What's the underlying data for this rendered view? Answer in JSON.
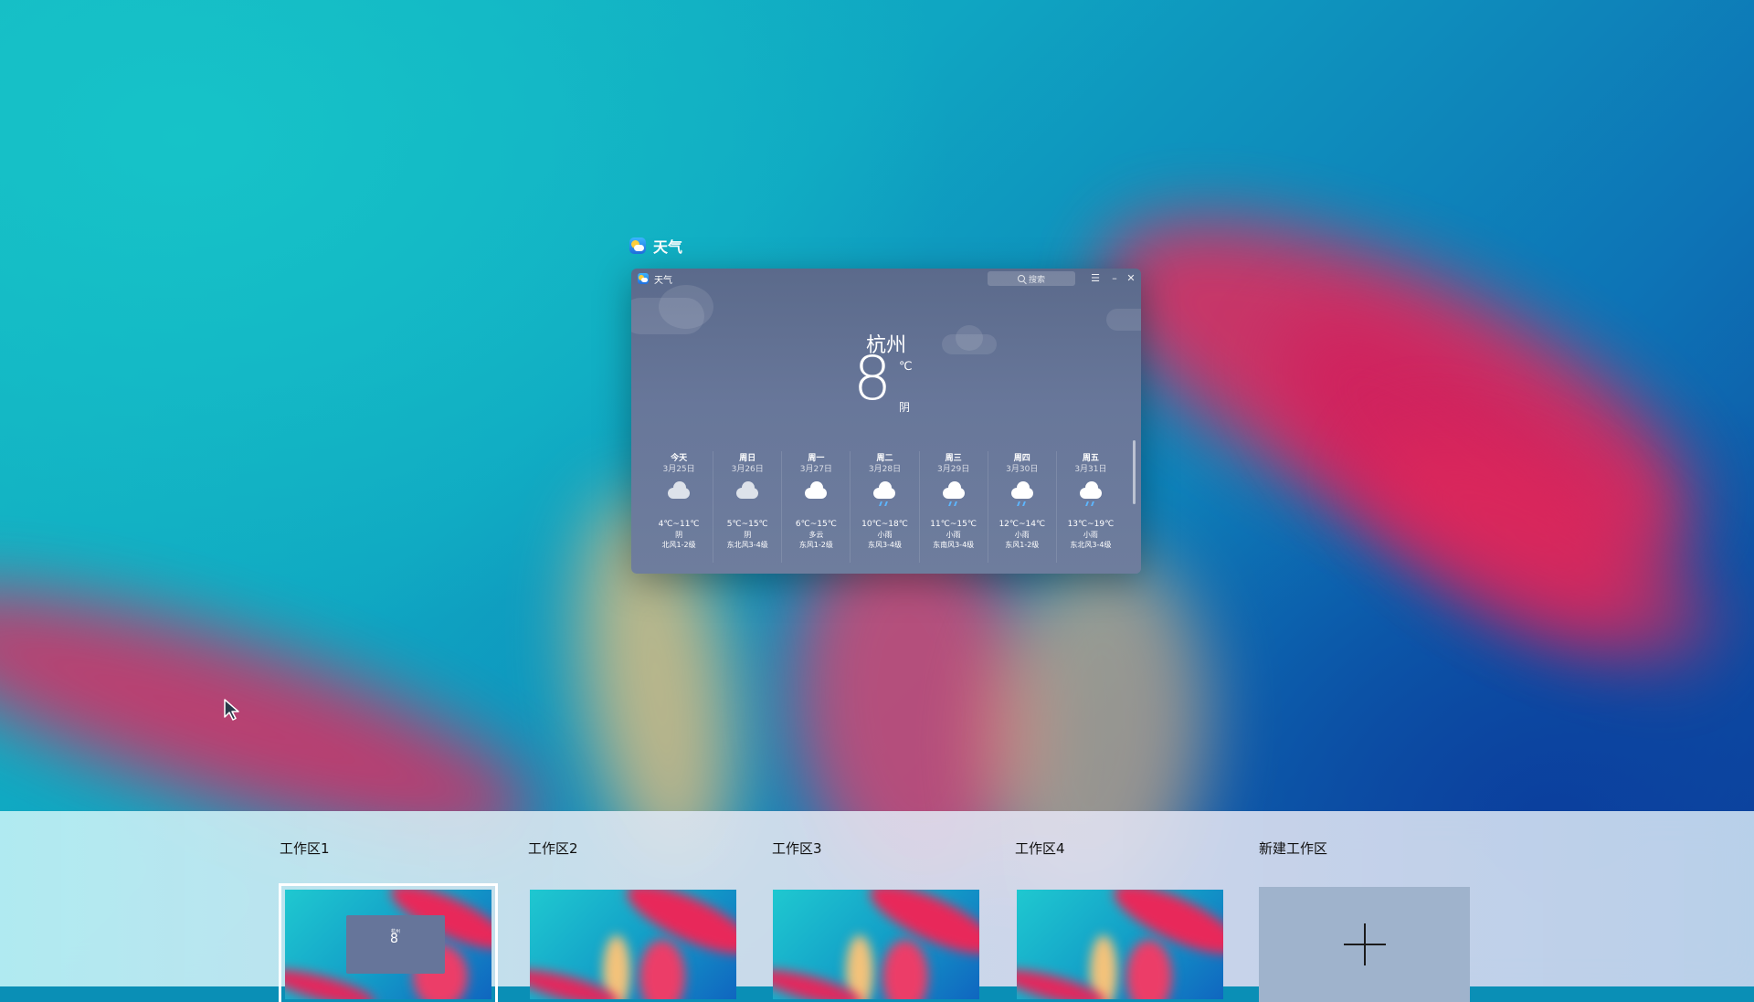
{
  "window_label": {
    "title": "天气",
    "icon": "weather-app-icon"
  },
  "weather_window": {
    "title": "天气",
    "search_placeholder": "搜索",
    "menu_icon": "☰",
    "minimize_icon": "–",
    "close_icon": "✕",
    "city": "杭州",
    "current_temp": "8",
    "unit": "℃",
    "condition": "阴",
    "forecast": [
      {
        "day": "今天",
        "date": "3月25日",
        "icon": "cloudy-icon",
        "range": "4℃~11℃",
        "cond": "阴",
        "wind": "北风1-2级"
      },
      {
        "day": "周日",
        "date": "3月26日",
        "icon": "cloudy-icon",
        "range": "5℃~15℃",
        "cond": "阴",
        "wind": "东北风3-4级"
      },
      {
        "day": "周一",
        "date": "3月27日",
        "icon": "partly-cloudy-icon",
        "range": "6℃~15℃",
        "cond": "多云",
        "wind": "东风1-2级"
      },
      {
        "day": "周二",
        "date": "3月28日",
        "icon": "light-rain-icon",
        "range": "10℃~18℃",
        "cond": "小雨",
        "wind": "东风3-4级"
      },
      {
        "day": "周三",
        "date": "3月29日",
        "icon": "light-rain-icon",
        "range": "11℃~15℃",
        "cond": "小雨",
        "wind": "东南风3-4级"
      },
      {
        "day": "周四",
        "date": "3月30日",
        "icon": "light-rain-icon",
        "range": "12℃~14℃",
        "cond": "小雨",
        "wind": "东风1-2级"
      },
      {
        "day": "周五",
        "date": "3月31日",
        "icon": "light-rain-icon",
        "range": "13℃~19℃",
        "cond": "小雨",
        "wind": "东北风3-4级"
      }
    ]
  },
  "workspaces": {
    "items": [
      {
        "label": "工作区1",
        "active": true
      },
      {
        "label": "工作区2",
        "active": false
      },
      {
        "label": "工作区3",
        "active": false
      },
      {
        "label": "工作区4",
        "active": false
      }
    ],
    "new_label": "新建工作区",
    "mini_city": "杭州",
    "mini_temp": "8"
  },
  "colors": {
    "wallpaper_teal": "#15b8c4",
    "wallpaper_blue": "#0f3f99",
    "streak_red": "#e8285a",
    "window_bg": "#5b6a8b",
    "new_workspace_bg": "#9fb3cc"
  }
}
